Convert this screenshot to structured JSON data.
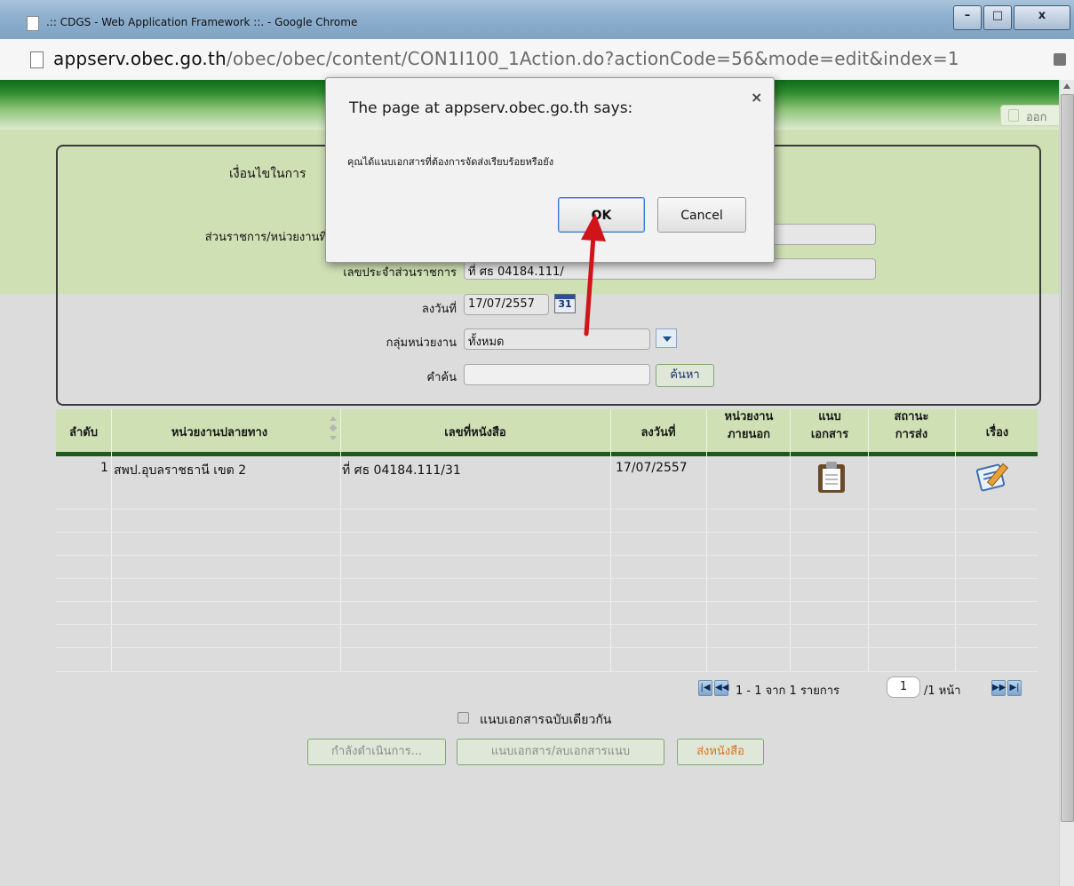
{
  "browser": {
    "window_title": ".:: CDGS - Web Application Framework ::. - Google Chrome",
    "url_host": "appserv.obec.go.th",
    "url_path": "/obec/obec/content/CON1I100_1Action.do?actionCode=56&mode=edit&index=1",
    "window_buttons": {
      "minimize": "–",
      "maximize": "□",
      "close": "x"
    }
  },
  "header": {
    "logout_label": "ออก"
  },
  "form": {
    "title_partial": "เงื่อนไขในการ",
    "agency_label": "ส่วนราชการ/หน่วยงานที่",
    "agency_value": "",
    "ref_label": "เลขประจำส่วนราชการ",
    "ref_value": "ที่ ศธ 04184.111/",
    "date_label": "ลงวันที่",
    "date_value": "17/07/2557",
    "calendar_icon_text": "31",
    "group_label": "กลุ่มหน่วยงาน",
    "group_value": "ทั้งหมด",
    "keyword_label": "คำค้น",
    "keyword_value": "",
    "search_button": "ค้นหา"
  },
  "table": {
    "headers": [
      "ลำดับ",
      "หน่วยงานปลายทาง",
      "เลขที่หนังสือ",
      "ลงวันที่",
      "หน่วยงาน",
      "ภายนอก",
      "แนบ",
      "เอกสาร",
      "สถานะ",
      "การส่ง",
      "เรื่อง"
    ],
    "rows": [
      {
        "no": "1",
        "destination": "สพป.อุบลราชธานี เขต 2",
        "doc_no": "ที่ ศธ 04184.111/31",
        "date": "17/07/2557",
        "external": "",
        "status": ""
      }
    ]
  },
  "pager": {
    "range_text": "1 - 1 จาก 1 รายการ",
    "page_value": "1",
    "total_text": "/1 หน้า"
  },
  "actions": {
    "same_doc_checkbox_label": "แนบเอกสารฉบับเดียวกัน",
    "processing_button": "กำลังดำเนินการ...",
    "attach_button": "แนบเอกสาร/ลบเอกสารแนบ",
    "send_button": "ส่งหนังสือ"
  },
  "dialog": {
    "title": "The page at appserv.obec.go.th says:",
    "message": "คุณได้แนบเอกสารที่ต้องการจัดส่งเรียบร้อยหรือยัง",
    "ok_label": "OK",
    "cancel_label": "Cancel",
    "close_glyph": "×"
  },
  "colors": {
    "arrow": "#d0141a",
    "header_green": "#cfe0b4",
    "dark_green": "#1e5a1e"
  }
}
